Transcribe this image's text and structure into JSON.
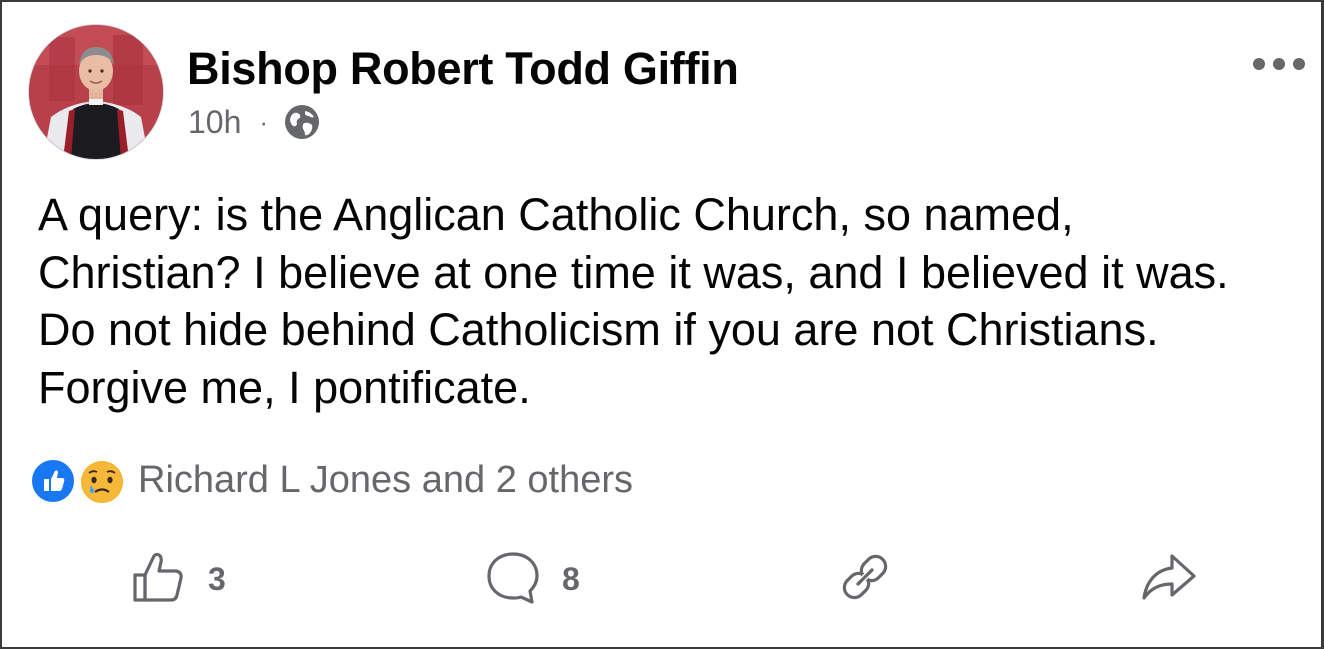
{
  "post": {
    "author": "Bishop Robert Todd Giffin",
    "time": "10h",
    "separator": "·",
    "audience_icon": "globe-icon",
    "more_icon": "ellipsis-icon",
    "text": "A query: is the Anglican Catholic Church, so named, Christian? I believe at one time it was, and I believed it was. Do not hide behind Catholicism if you are not Christians. Forgive me, I pontificate."
  },
  "reactions": {
    "icons": [
      "like-icon",
      "sad-icon"
    ],
    "summary": "Richard L Jones and 2 others"
  },
  "actions": {
    "like": {
      "icon": "thumbs-up-icon",
      "count": "3"
    },
    "comment": {
      "icon": "comment-bubble-icon",
      "count": "8"
    },
    "link": {
      "icon": "link-icon"
    },
    "share": {
      "icon": "share-arrow-icon"
    }
  },
  "colors": {
    "text": "#050505",
    "secondary": "#65676b",
    "like_blue": "#1877f2",
    "sad_yellow": "#f7b125",
    "border": "#3a3a3a"
  }
}
